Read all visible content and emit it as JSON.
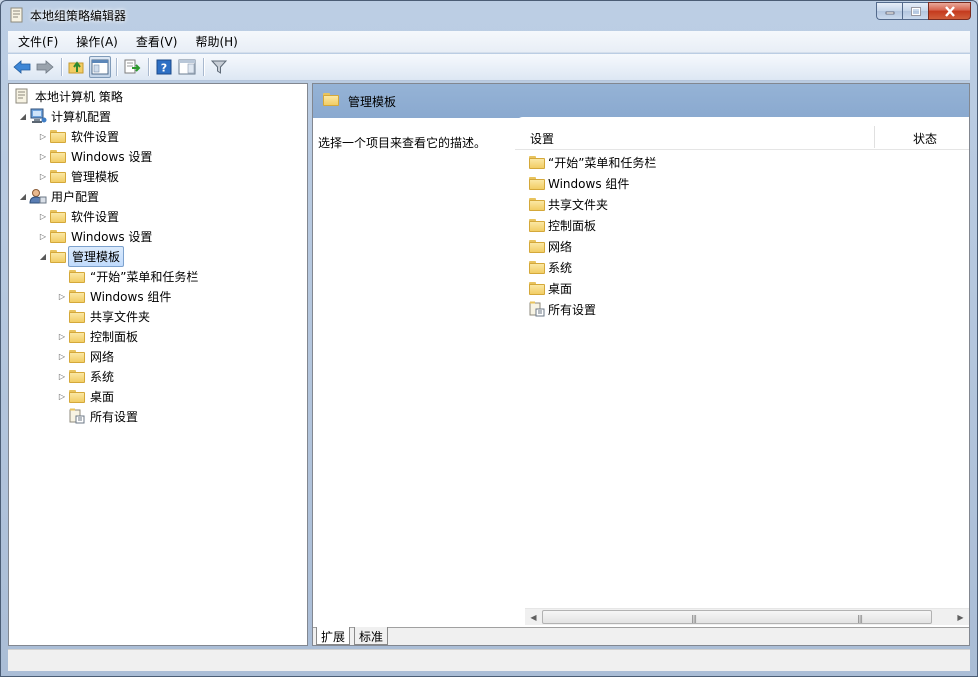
{
  "window": {
    "title": "本地组策略编辑器"
  },
  "menubar": {
    "items": [
      "文件(F)",
      "操作(A)",
      "查看(V)",
      "帮助(H)"
    ]
  },
  "tree": {
    "root": "本地计算机 策略",
    "computer_config": "计算机配置",
    "cc_software": "软件设置",
    "cc_windows": "Windows 设置",
    "cc_admin": "管理模板",
    "user_config": "用户配置",
    "uc_software": "软件设置",
    "uc_windows": "Windows 设置",
    "uc_admin": "管理模板",
    "uc_admin_children": [
      "“开始”菜单和任务栏",
      "Windows 组件",
      "共享文件夹",
      "控制面板",
      "网络",
      "系统",
      "桌面",
      "所有设置"
    ]
  },
  "right_pane": {
    "header_title": "管理模板",
    "description": "选择一个项目来查看它的描述。",
    "columns": [
      "设置",
      "状态"
    ],
    "items": [
      "“开始”菜单和任务栏",
      "Windows 组件",
      "共享文件夹",
      "控制面板",
      "网络",
      "系统",
      "桌面",
      "所有设置"
    ]
  },
  "bottom_tabs": [
    "扩展",
    "标准"
  ],
  "colors": {
    "header_bg": "#8aa9cf",
    "selection_bg": "#c1dbfc",
    "folder_yellow": "#f2cd64"
  }
}
